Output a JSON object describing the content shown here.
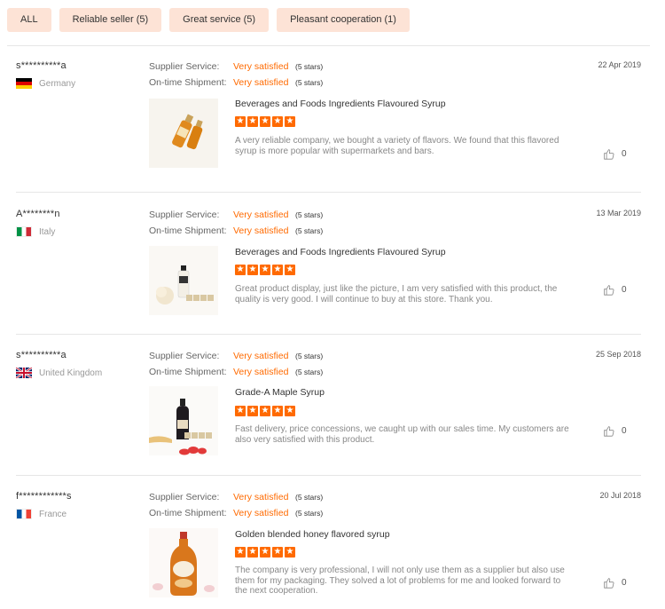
{
  "filters": [
    "ALL",
    "Reliable seller (5)",
    "Great service (5)",
    "Pleasant cooperation (1)"
  ],
  "labels": {
    "supplier_service": "Supplier Service:",
    "ontime_shipment": "On-time Shipment:"
  },
  "reviews": [
    {
      "reviewer": "s**********a",
      "country": "Germany",
      "flag": "flag-de",
      "date": "22 Apr 2019",
      "supplier_value": "Very satisfied",
      "supplier_stars": "(5 stars)",
      "shipment_value": "Very satisfied",
      "shipment_stars": "(5 stars)",
      "product": "Beverages and Foods Ingredients Flavoured Syrup",
      "rating": 5,
      "text": "A very reliable company, we bought a variety of flavors. We found that this flavored syrup is more popular with supermarkets and bars.",
      "likes": "0",
      "thumb_icon": "syrup-bottles-image"
    },
    {
      "reviewer": "A********n",
      "country": "Italy",
      "flag": "flag-it",
      "date": "13 Mar 2019",
      "supplier_value": "Very satisfied",
      "supplier_stars": "(5 stars)",
      "shipment_value": "Very satisfied",
      "shipment_stars": "(5 stars)",
      "product": "Beverages and Foods Ingredients Flavoured Syrup",
      "rating": 5,
      "text": "Great product display, just like the picture, I am very satisfied with this product, the quality is very good. I will continue to buy at this store. Thank you.",
      "likes": "0",
      "thumb_icon": "milk-syrup-bottle-image"
    },
    {
      "reviewer": "s**********a",
      "country": "United Kingdom",
      "flag": "flag-uk",
      "date": "25 Sep 2018",
      "supplier_value": "Very satisfied",
      "supplier_stars": "(5 stars)",
      "shipment_value": "Very satisfied",
      "shipment_stars": "(5 stars)",
      "product": "Grade-A Maple Syrup",
      "rating": 5,
      "text": "Fast delivery, price concessions, we caught up with our sales time. My customers are also very satisfied with this product.",
      "likes": "0",
      "thumb_icon": "maple-syrup-bottle-image"
    },
    {
      "reviewer": "f************s",
      "country": "France",
      "flag": "flag-fr",
      "date": "20 Jul 2018",
      "supplier_value": "Very satisfied",
      "supplier_stars": "(5 stars)",
      "shipment_value": "Very satisfied",
      "shipment_stars": "(5 stars)",
      "product": "Golden blended honey flavored syrup",
      "rating": 5,
      "text": "The company is very professional, I will not only use them as a supplier but also use them for my packaging. They solved a lot of problems for me and looked forward to the next cooperation.",
      "likes": "0",
      "thumb_icon": "honey-syrup-bottle-image"
    }
  ],
  "colors": {
    "accent": "#ff6a00",
    "chip_bg": "#fde3d6"
  }
}
